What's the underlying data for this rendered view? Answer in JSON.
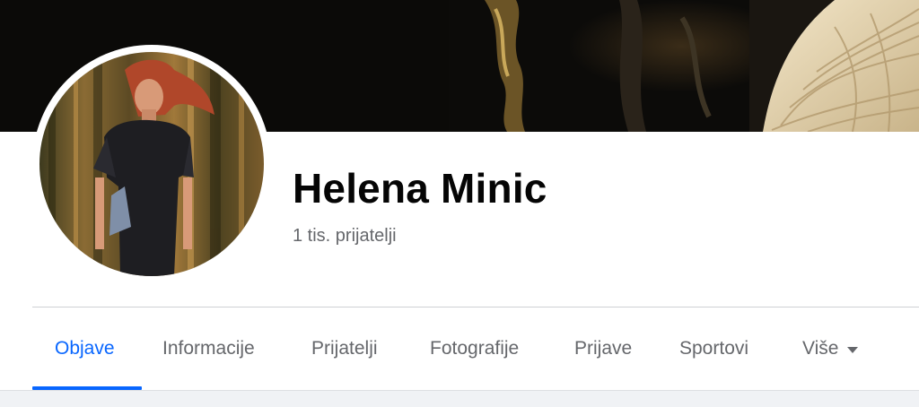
{
  "profile": {
    "name": "Helena Minic",
    "friends": "1 tis. prijatelji"
  },
  "tabs": [
    {
      "label": "Objave",
      "active": true
    },
    {
      "label": "Informacije",
      "active": false
    },
    {
      "label": "Prijatelji",
      "active": false
    },
    {
      "label": "Fotografije",
      "active": false
    },
    {
      "label": "Prijave",
      "active": false
    },
    {
      "label": "Sportovi",
      "active": false
    },
    {
      "label": "Više",
      "active": false,
      "icon": "caret-down-icon"
    }
  ],
  "colors": {
    "accent": "#0866ff",
    "text_primary": "#050505",
    "text_secondary": "#65676b",
    "divider": "#ced0d4"
  }
}
